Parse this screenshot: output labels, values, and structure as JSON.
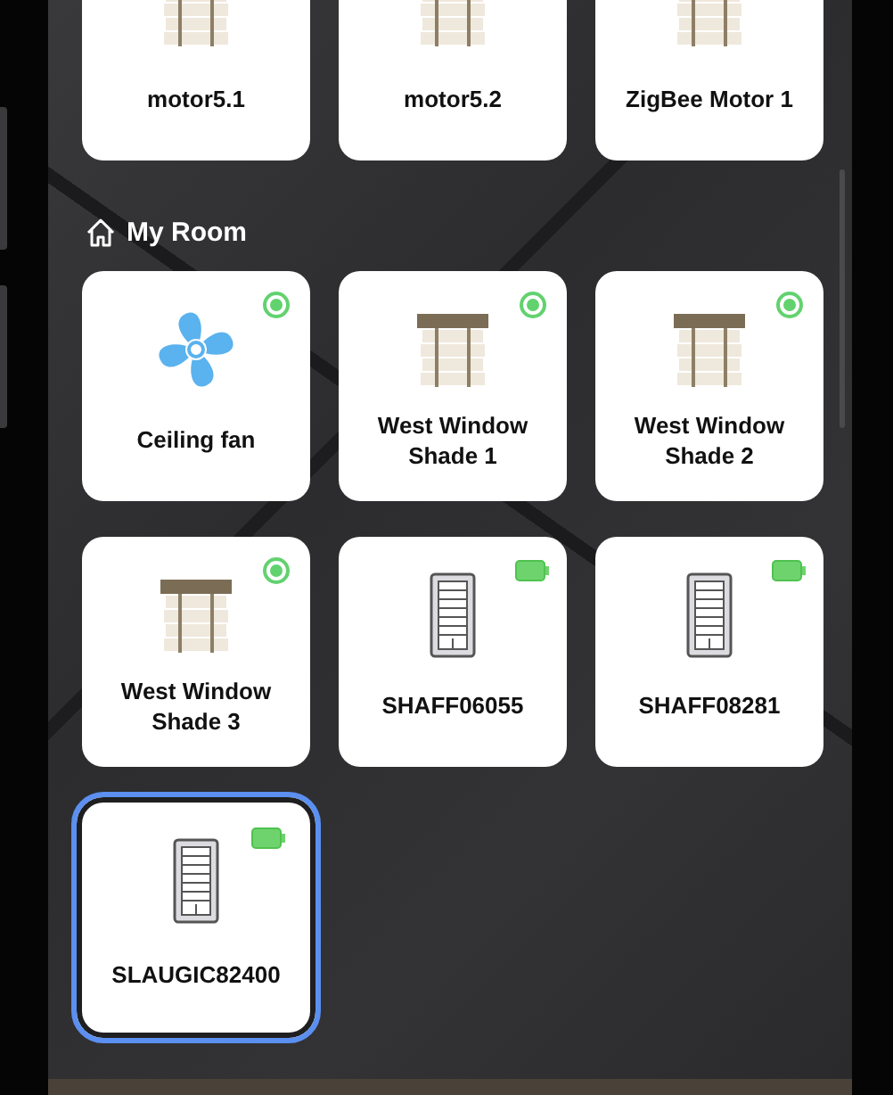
{
  "sections": [
    {
      "devices": [
        {
          "name": "motor5.1",
          "kind": "shade",
          "selected": false
        },
        {
          "name": "motor5.2",
          "kind": "shade",
          "selected": false
        },
        {
          "name": "ZigBee Motor 1",
          "kind": "shade",
          "selected": false
        }
      ]
    },
    {
      "title": "My Room",
      "devices": [
        {
          "name": "Ceiling fan",
          "kind": "fan",
          "badge": {
            "kind": "online"
          },
          "selected": false
        },
        {
          "name": "West Window Shade 1",
          "kind": "shade",
          "badge": {
            "kind": "online"
          },
          "selected": false
        },
        {
          "name": "West Window Shade 2",
          "kind": "shade",
          "badge": {
            "kind": "online"
          },
          "selected": false
        },
        {
          "name": "West Window Shade 3",
          "kind": "shade",
          "badge": {
            "kind": "online"
          },
          "selected": false
        },
        {
          "name": "SHAFF06055",
          "kind": "keypad",
          "badge": {
            "kind": "battery"
          },
          "selected": false
        },
        {
          "name": "SHAFF08281",
          "kind": "keypad",
          "badge": {
            "kind": "battery"
          },
          "selected": false
        },
        {
          "name": "SLAUGIC82400",
          "kind": "keypad",
          "badge": {
            "kind": "battery"
          },
          "selected": true
        }
      ]
    }
  ]
}
